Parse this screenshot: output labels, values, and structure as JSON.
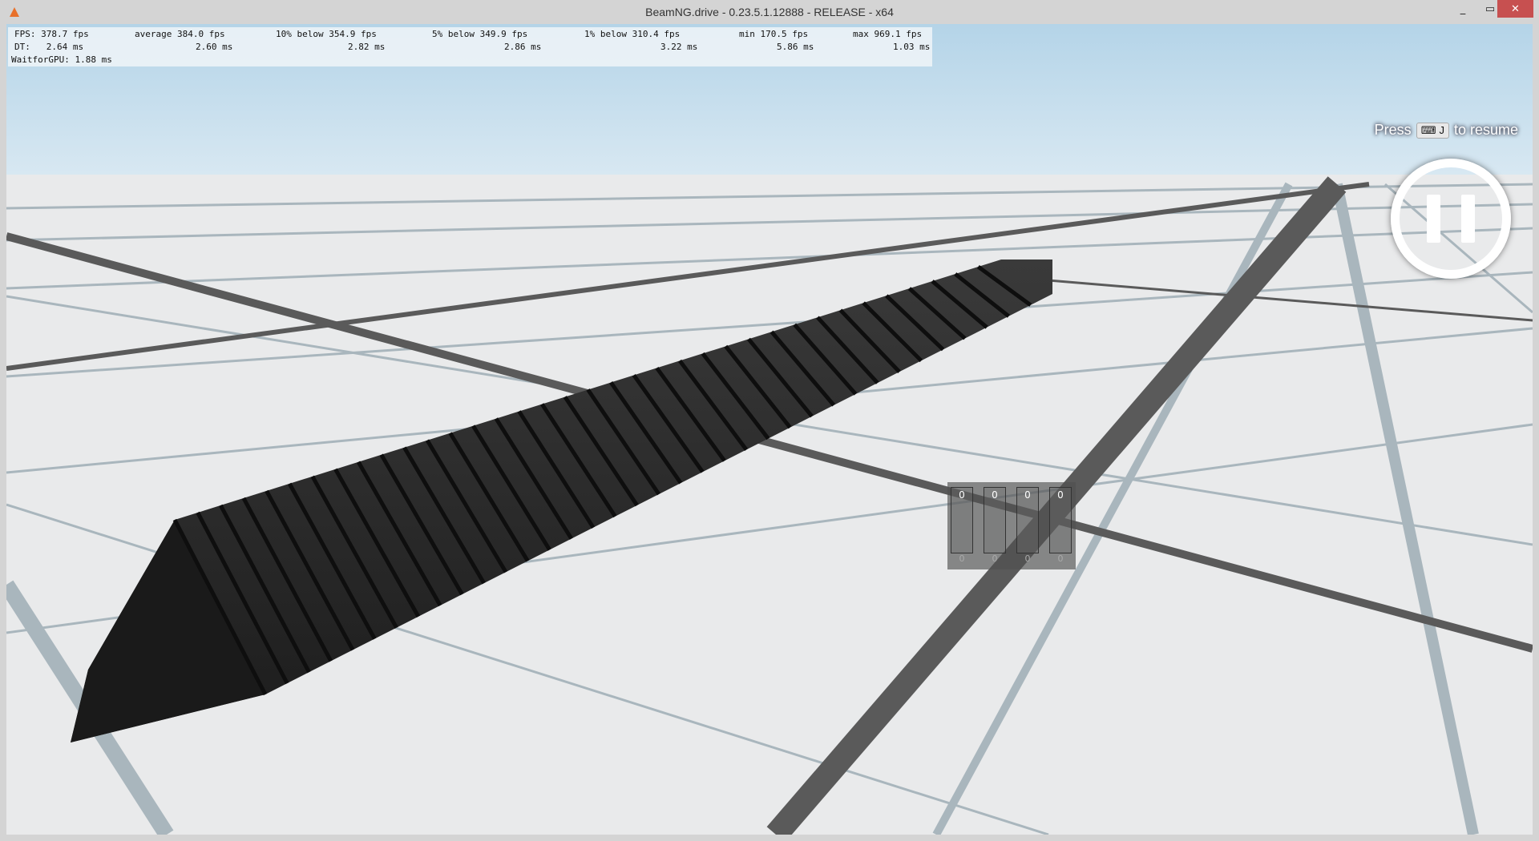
{
  "window": {
    "title": "BeamNG.drive - 0.23.5.1.12888 - RELEASE - x64",
    "minimize": "_",
    "maximize": "▭",
    "close": "✕"
  },
  "stats": {
    "row1": [
      "FPS: 378.7 fps",
      "average 384.0 fps",
      "10% below 354.9 fps",
      "5% below 349.9 fps",
      "1% below 310.4 fps",
      "min 170.5 fps",
      "max 969.1 fps"
    ],
    "row2": [
      "DT:   2.64 ms",
      "2.60 ms",
      "2.82 ms",
      "2.86 ms",
      "3.22 ms",
      "5.86 ms",
      "1.03 ms"
    ],
    "row3": "WaitforGPU: 1.88 ms"
  },
  "resume": {
    "press": "Press",
    "key": "J",
    "suffix": "to resume"
  },
  "widget": {
    "top": [
      "0",
      "0",
      "0",
      "0"
    ],
    "bottom": [
      "0",
      "0",
      "0",
      "0"
    ]
  },
  "colors": {
    "sky_top": "#b4d4e8",
    "sky_bottom": "#d8e8f2",
    "floor": "#e8e9ea",
    "beam": "#262626",
    "close": "#c75050"
  }
}
